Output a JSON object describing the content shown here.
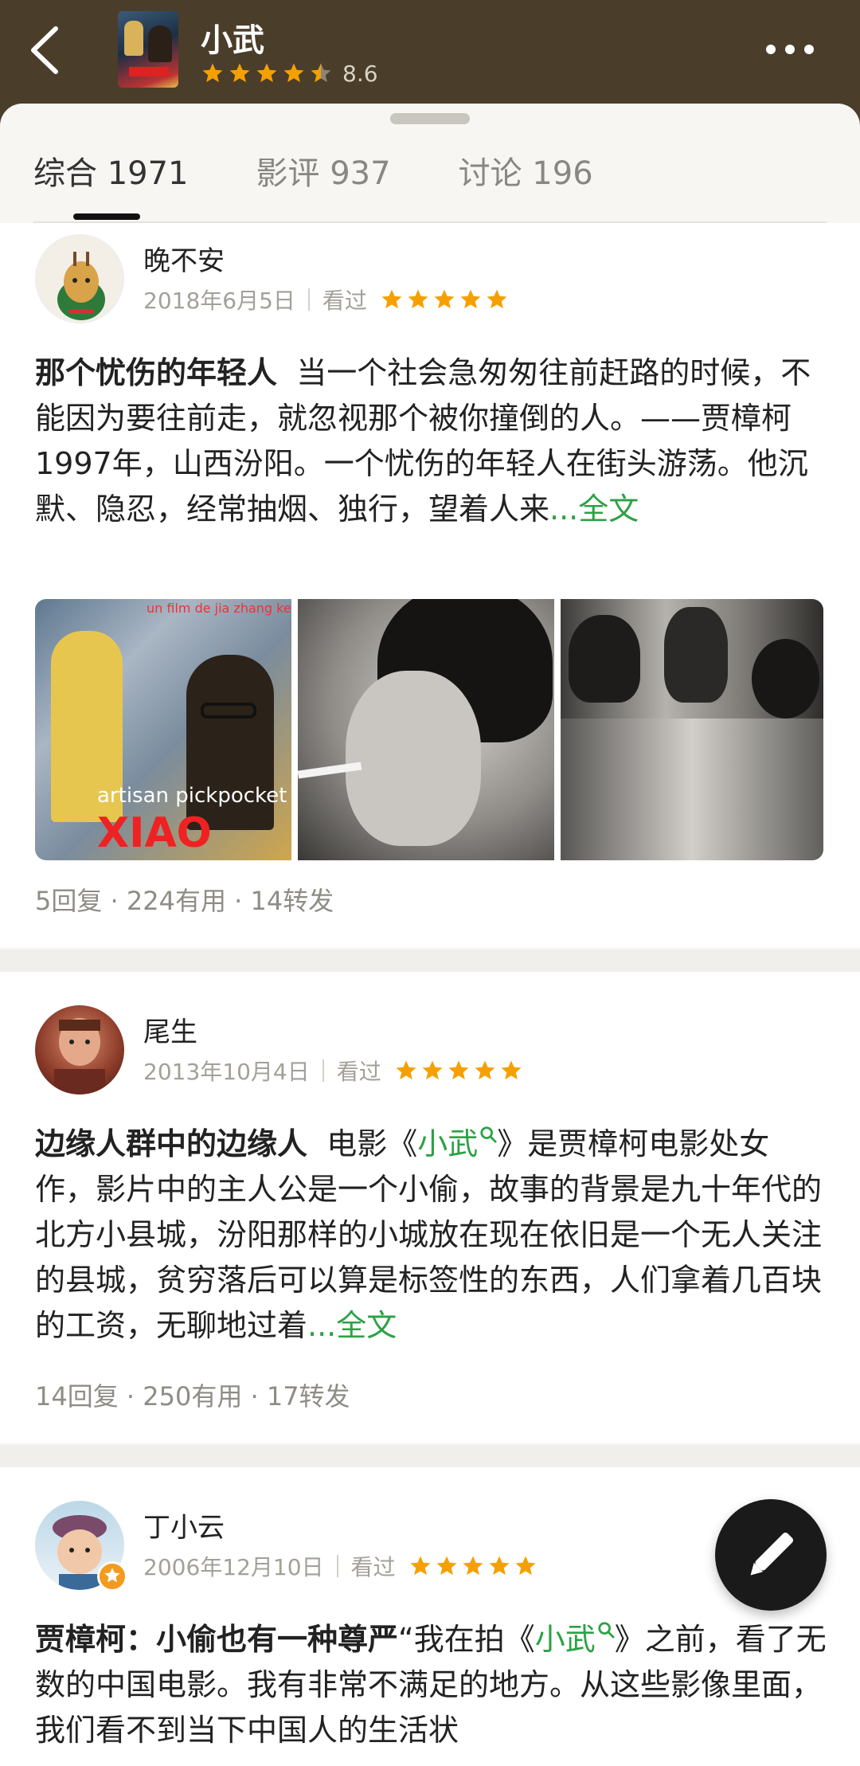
{
  "header": {
    "title": "小武",
    "rating": "8.6",
    "stars_filled": 4.5,
    "icons": {
      "back": "back-arrow-icon",
      "more": "more-dots-icon"
    }
  },
  "tabs": [
    {
      "label": "综合 1971",
      "active": true
    },
    {
      "label": "影评 937",
      "active": false
    },
    {
      "label": "讨论 196",
      "active": false
    }
  ],
  "reviews": [
    {
      "username": "晚不安",
      "date": "2018年6月5日",
      "status": "看过",
      "stars": 5,
      "title": "那个忧伤的年轻人",
      "excerpt": "当一个社会急匆匆往前赶路的时候，不能因为要往前走，就忽视那个被你撞倒的人。——贾樟柯",
      "excerpt2": "1997年，山西汾阳。一个忧伤的年轻人在街头游荡。他沉默、隐忍，经常抽烟、独行，望着人来",
      "more": "...全文",
      "images": [
        {
          "top_text": "un film de jia zhang ke",
          "bottom_text": "artisan pickpocket",
          "logo": "XIAO WU"
        },
        {},
        {}
      ],
      "stats": "5回复 · 224有用 · 14转发"
    },
    {
      "username": "尾生",
      "date": "2013年10月4日",
      "status": "看过",
      "stars": 5,
      "title": "边缘人群中的边缘人",
      "excerpt_before": "电影《",
      "link": "小武",
      "excerpt_after": "》是贾樟柯电影处女作，影片中的主人公是一个小偷，故事的背景是九十年代的北方小县城，汾阳那样的小城放在现在依旧是一个无人关注的县城，贫穷落后可以算是标签性的东西，人们拿着几百块的工资，无聊地过着",
      "more": "...全文",
      "stats": "14回复 · 250有用 · 17转发"
    },
    {
      "username": "丁小云",
      "date": "2006年12月10日",
      "status": "看过",
      "stars": 5,
      "title": "贾樟柯：小偷也有一种尊严",
      "excerpt_before": "“我在拍《",
      "link": "小武",
      "excerpt_after": "》之前，看了无数的中国电影。我有非常不满足的地方。从这些影像里面，我们看不到当下中国人的生活状"
    }
  ],
  "fab": {
    "icon": "pencil-icon"
  },
  "colors": {
    "header_bg": "#4a3d2a",
    "star": "#f5a000",
    "link_green": "#2ba244"
  }
}
